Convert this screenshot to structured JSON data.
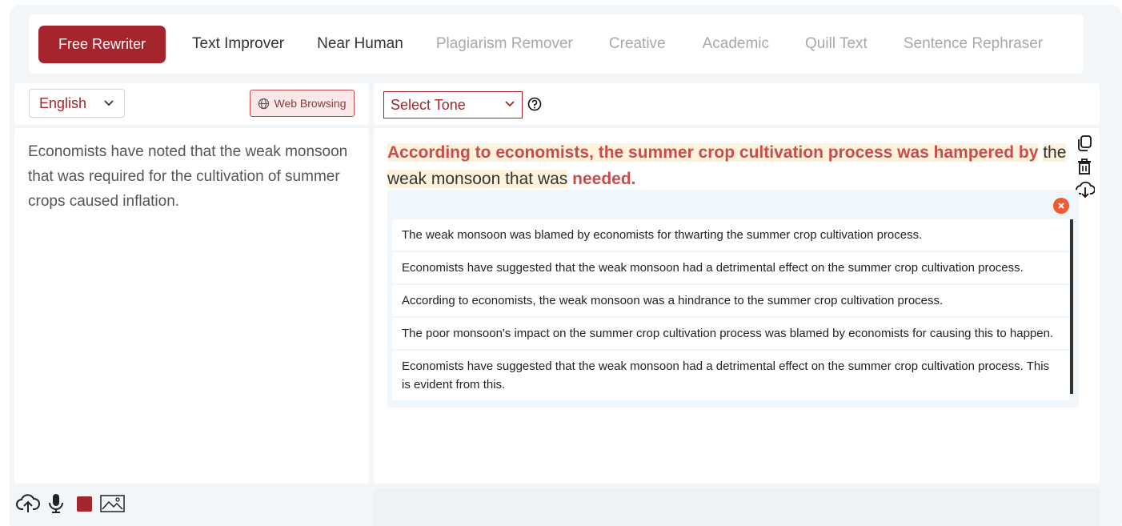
{
  "tabs": [
    {
      "label": "Free Rewriter"
    },
    {
      "label": "Text Improver"
    },
    {
      "label": "Near Human"
    },
    {
      "label": "Plagiarism Remover"
    },
    {
      "label": "Creative"
    },
    {
      "label": "Academic"
    },
    {
      "label": "Quill Text"
    },
    {
      "label": "Sentence Rephraser"
    }
  ],
  "left": {
    "language": "English",
    "web_browsing_label": "Web Browsing",
    "input_text": "Economists have noted that the weak monsoon that was required for the cultivation of summer crops caused inflation."
  },
  "right": {
    "tone_placeholder": "Select Tone",
    "output": {
      "part1": "According to economists, the summer crop cultivation process was hampered by",
      "part2": "the weak monsoon that was",
      "part3": "needed."
    },
    "suggestions": [
      "The weak monsoon was blamed by economists for thwarting the summer crop cultivation process.",
      "Economists have suggested that the weak monsoon had a detrimental effect on the summer crop cultivation process.",
      "According to economists, the weak monsoon was a hindrance to the summer crop cultivation process.",
      "The poor monsoon's impact on the summer crop cultivation process was blamed by economists for causing this to happen.",
      "Economists have suggested that the weak monsoon had a detrimental effect on the summer crop cultivation process. This is evident from this."
    ]
  },
  "colors": {
    "accent": "#a4262c",
    "highlight": "#fdf3dc",
    "close": "#ef5a31"
  }
}
